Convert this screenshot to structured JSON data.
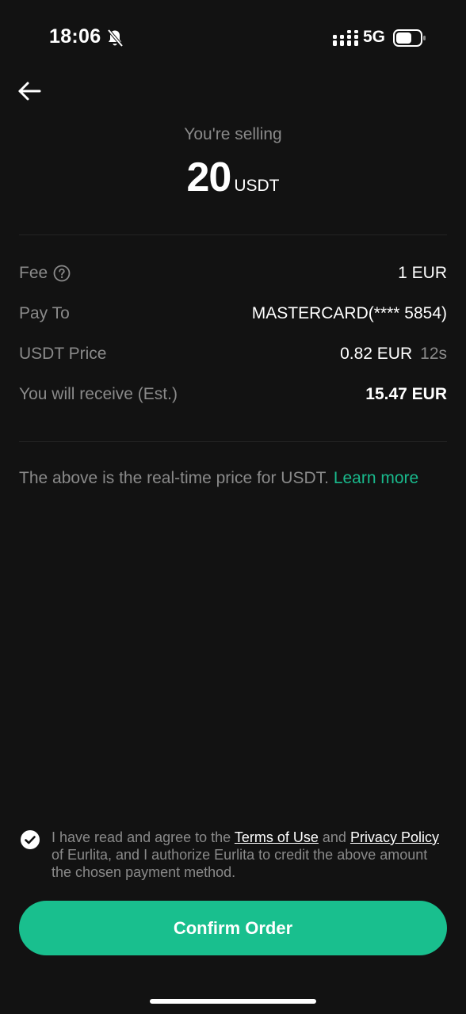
{
  "status_bar": {
    "time": "18:06",
    "network": "5G",
    "icons": [
      "bell-muted-icon",
      "signal-icon",
      "battery-icon"
    ]
  },
  "header": {
    "back_icon": "arrow-left-icon"
  },
  "summary": {
    "caption": "You're selling",
    "amount": "20",
    "unit": "USDT"
  },
  "details": {
    "fee": {
      "label": "Fee",
      "value": "1 EUR",
      "icon": "question-circle-icon"
    },
    "pay_to": {
      "label": "Pay To",
      "value": "MASTERCARD(**** 5854)"
    },
    "usdt_price": {
      "label": "USDT Price",
      "value": "0.82 EUR",
      "timer": "12s"
    },
    "receive": {
      "label": "You will receive (Est.)",
      "value": "15.47 EUR"
    }
  },
  "price_note": {
    "text": "The above is the real-time price for USDT.",
    "link": "Learn more"
  },
  "agreement": {
    "checked": true,
    "prefix": "I have read and agree to the ",
    "terms_link": "Terms of Use",
    "middle": " and ",
    "privacy_link": "Privacy Policy",
    "suffix": " of Eurlita, and I authorize Eurlita to credit the above amount the chosen payment method."
  },
  "actions": {
    "confirm_label": "Confirm Order"
  },
  "colors": {
    "background": "#121212",
    "accent": "#19bf8e",
    "link": "#19b98c",
    "muted_text": "#8a8a8a"
  }
}
